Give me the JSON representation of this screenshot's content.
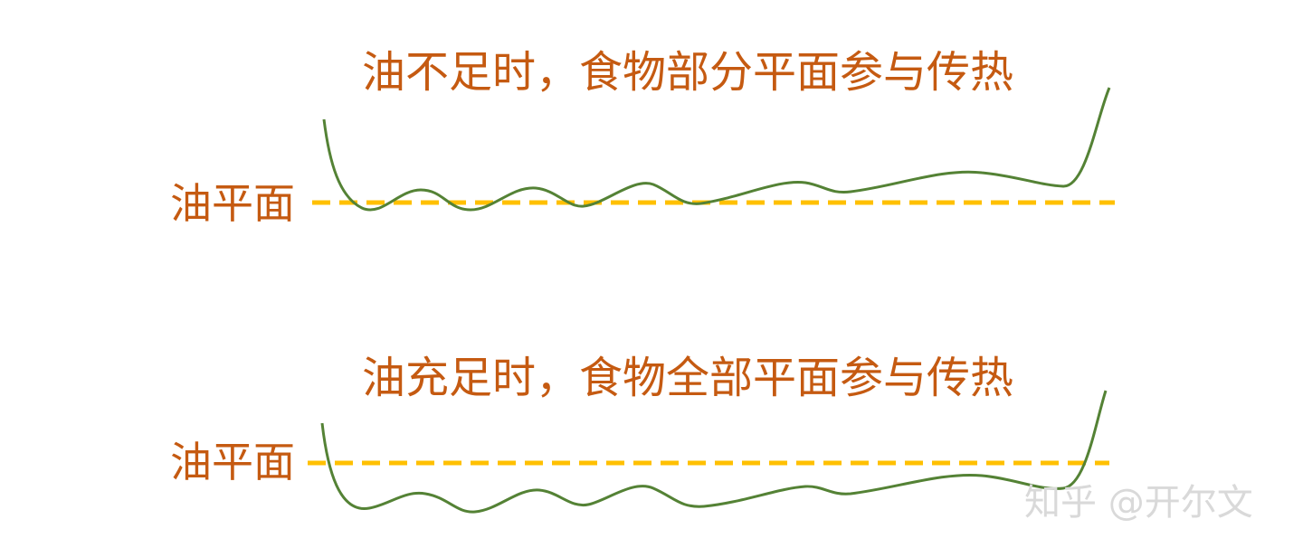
{
  "colors": {
    "text": "#c55a11",
    "oil_line": "#ffc000",
    "food_curve": "#548235",
    "watermark": "#d9d9d9",
    "background": "#ffffff"
  },
  "panels": [
    {
      "caption": "油不足时，食物部分平面参与传热",
      "oil_level_label": "油平面"
    },
    {
      "caption": "油充足时，食物全部平面参与传热",
      "oil_level_label": "油平面"
    }
  ],
  "watermark": "知乎 @开尔文"
}
